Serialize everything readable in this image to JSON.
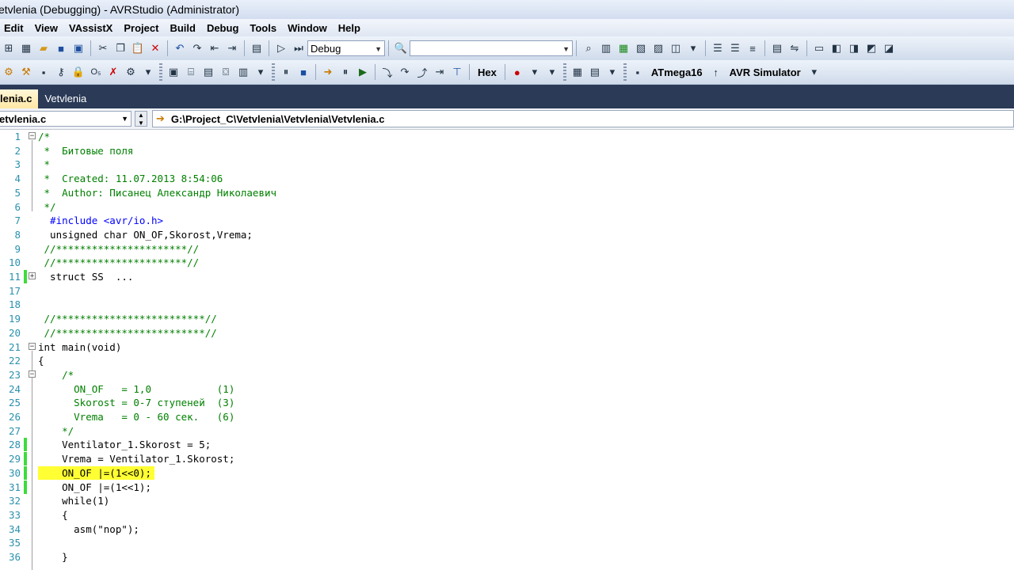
{
  "window": {
    "title": "etvlenia (Debugging) - AVRStudio (Administrator)"
  },
  "menu": [
    "Edit",
    "View",
    "VAssistX",
    "Project",
    "Build",
    "Debug",
    "Tools",
    "Window",
    "Help"
  ],
  "toolbar": {
    "config_combo": "Debug",
    "search_combo": "",
    "hex_label": "Hex",
    "device_label": "ATmega16",
    "tool_label": "AVR Simulator"
  },
  "tabs": {
    "active": "lenia.c",
    "inactive": "Vetvlenia"
  },
  "nav": {
    "file_combo": "etvlenia.c",
    "path": "G:\\Project_C\\Vetvlenia\\Vetvlenia\\Vetvlenia.c"
  },
  "editor": {
    "current_line": "30",
    "lines": [
      {
        "n": "1",
        "text": "/*"
      },
      {
        "n": "2",
        "text": " *  Битовые поля"
      },
      {
        "n": "3",
        "text": " *"
      },
      {
        "n": "4",
        "text": " *  Created: 11.07.2013 8:54:06"
      },
      {
        "n": "5",
        "text": " *  Author: Писанец Александр Николаевич"
      },
      {
        "n": "6",
        "text": " */"
      },
      {
        "n": "7",
        "text": "  #include <avr/io.h>"
      },
      {
        "n": "8",
        "text": "  unsigned char ON_OF,Skorost,Vrema;"
      },
      {
        "n": "9",
        "text": " //**********************//"
      },
      {
        "n": "10",
        "text": " //**********************//"
      },
      {
        "n": "11",
        "text": "  struct SS  ..."
      },
      {
        "n": "17",
        "text": ""
      },
      {
        "n": "18",
        "text": ""
      },
      {
        "n": "19",
        "text": " //*************************//"
      },
      {
        "n": "20",
        "text": " //*************************//"
      },
      {
        "n": "21",
        "text": "int main(void)"
      },
      {
        "n": "22",
        "text": "{"
      },
      {
        "n": "23",
        "text": "    /*"
      },
      {
        "n": "24",
        "text": "      ON_OF   = 1,0           (1)"
      },
      {
        "n": "25",
        "text": "      Skorost = 0-7 ступеней  (3)"
      },
      {
        "n": "26",
        "text": "      Vrema   = 0 - 60 сек.   (6)"
      },
      {
        "n": "27",
        "text": "    */"
      },
      {
        "n": "28",
        "text": "    Ventilator_1.Skorost = 5;"
      },
      {
        "n": "29",
        "text": "    Vrema = Ventilator_1.Skorost;"
      },
      {
        "n": "30",
        "text": "    ON_OF |=(1<<0);"
      },
      {
        "n": "31",
        "text": "    ON_OF |=(1<<1);"
      },
      {
        "n": "32",
        "text": "    while(1)"
      },
      {
        "n": "33",
        "text": "    {"
      },
      {
        "n": "34",
        "text": "      asm(\"nop\");"
      },
      {
        "n": "35",
        "text": ""
      },
      {
        "n": "36",
        "text": "    }"
      }
    ]
  },
  "colors": {
    "keyword": "#0000ff",
    "comment": "#008000",
    "line_number": "#2b91af",
    "highlight": "#ffff33",
    "change_bar": "#3cdc3c"
  }
}
